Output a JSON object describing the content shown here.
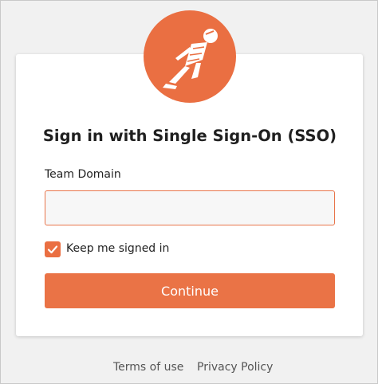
{
  "brand": {
    "accent_color": "#ea6f42",
    "logo_icon": "postman-astronaut-icon"
  },
  "login": {
    "title": "Sign in with Single Sign-On (SSO)",
    "team_domain_label": "Team Domain",
    "team_domain_value": "",
    "team_domain_placeholder": "",
    "keep_signed_in_label": "Keep me signed in",
    "keep_signed_in_checked": true,
    "continue_label": "Continue"
  },
  "footer": {
    "terms_label": "Terms of use",
    "privacy_label": "Privacy Policy"
  }
}
